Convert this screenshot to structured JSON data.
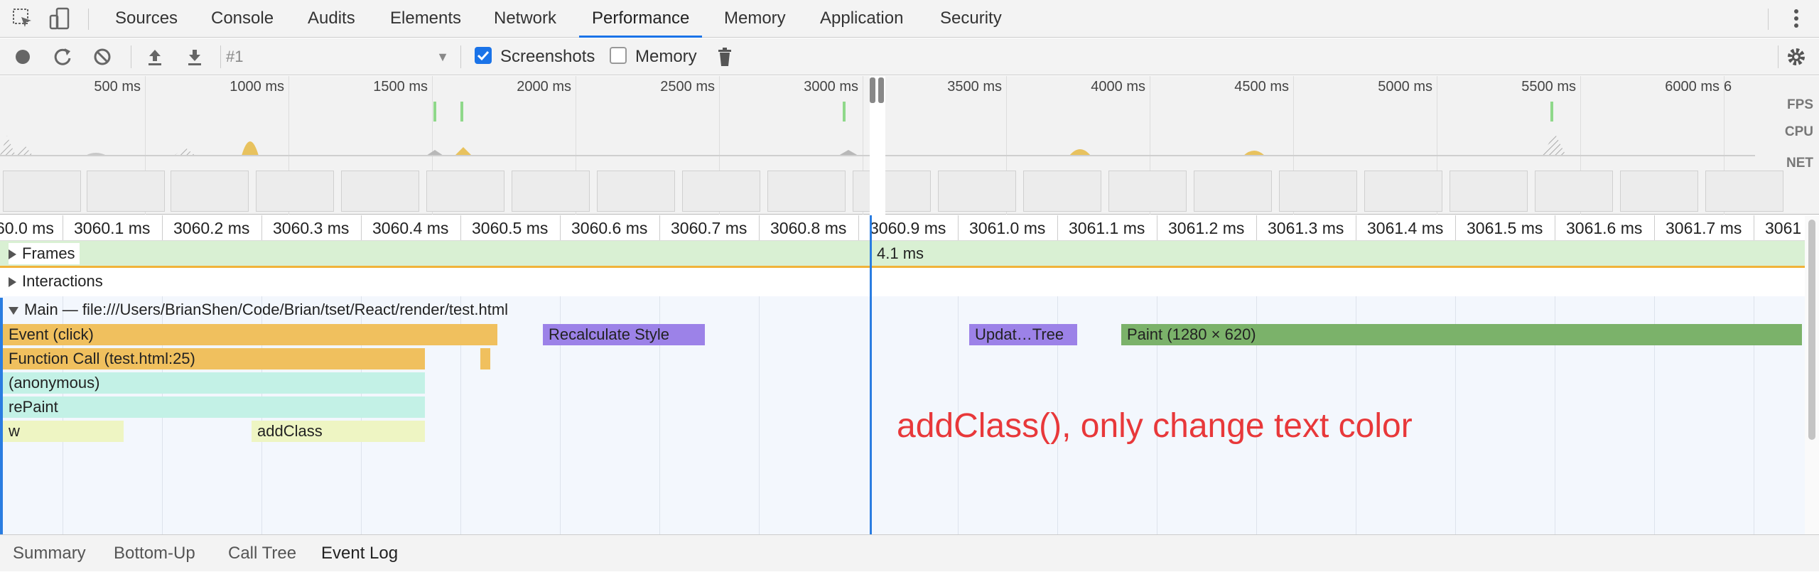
{
  "tabs": [
    "Sources",
    "Console",
    "Audits",
    "Elements",
    "Network",
    "Performance",
    "Memory",
    "Application",
    "Security"
  ],
  "active_tab": "Performance",
  "toolbar": {
    "profile_value": "#1",
    "screenshots_label": "Screenshots",
    "screenshots_checked": true,
    "memory_label": "Memory",
    "memory_checked": false
  },
  "overview": {
    "ticks": [
      "500 ms",
      "1000 ms",
      "1500 ms",
      "2000 ms",
      "2500 ms",
      "3000 ms",
      "3500 ms",
      "4000 ms",
      "4500 ms",
      "5000 ms",
      "5500 ms",
      "6000 ms",
      "6"
    ],
    "fps_label": "FPS",
    "cpu_label": "CPU",
    "net_label": "NET"
  },
  "ruler": [
    "60.0 ms",
    "3060.1 ms",
    "3060.2 ms",
    "3060.3 ms",
    "3060.4 ms",
    "3060.5 ms",
    "3060.6 ms",
    "3060.7 ms",
    "3060.8 ms",
    "3060.9 ms",
    "3061.0 ms",
    "3061.1 ms",
    "3061.2 ms",
    "3061.3 ms",
    "3061.4 ms",
    "3061.5 ms",
    "3061.6 ms",
    "3061.7 ms",
    "3061"
  ],
  "tracks": {
    "frames_label": "Frames",
    "frame_duration": "4.1 ms",
    "interactions_label": "Interactions",
    "main_label": "Main — file:///Users/BrianShen/Code/Brian/tset/React/render/test.html"
  },
  "flame": {
    "event_click": "Event (click)",
    "function_call": "Function Call (test.html:25)",
    "anonymous": "(anonymous)",
    "repaint": "rePaint",
    "w": "w",
    "addclass": "addClass",
    "recalculate_style": "Recalculate Style",
    "update_tree": "Updat…Tree",
    "paint": "Paint (1280 × 620)"
  },
  "annotation": "addClass(), only change text color",
  "bottom_tabs": [
    "Summary",
    "Bottom-Up",
    "Call Tree",
    "Event Log"
  ],
  "active_bottom_tab": "Event Log",
  "colors": {
    "scripting": "#f0c05e",
    "scripting_js": "#c3f1e6",
    "scripting_leaf": "#eef5c3",
    "rendering": "#9c82e8",
    "painting": "#7bb26a",
    "accent": "#1a73e8",
    "annotation": "#e8383a"
  }
}
